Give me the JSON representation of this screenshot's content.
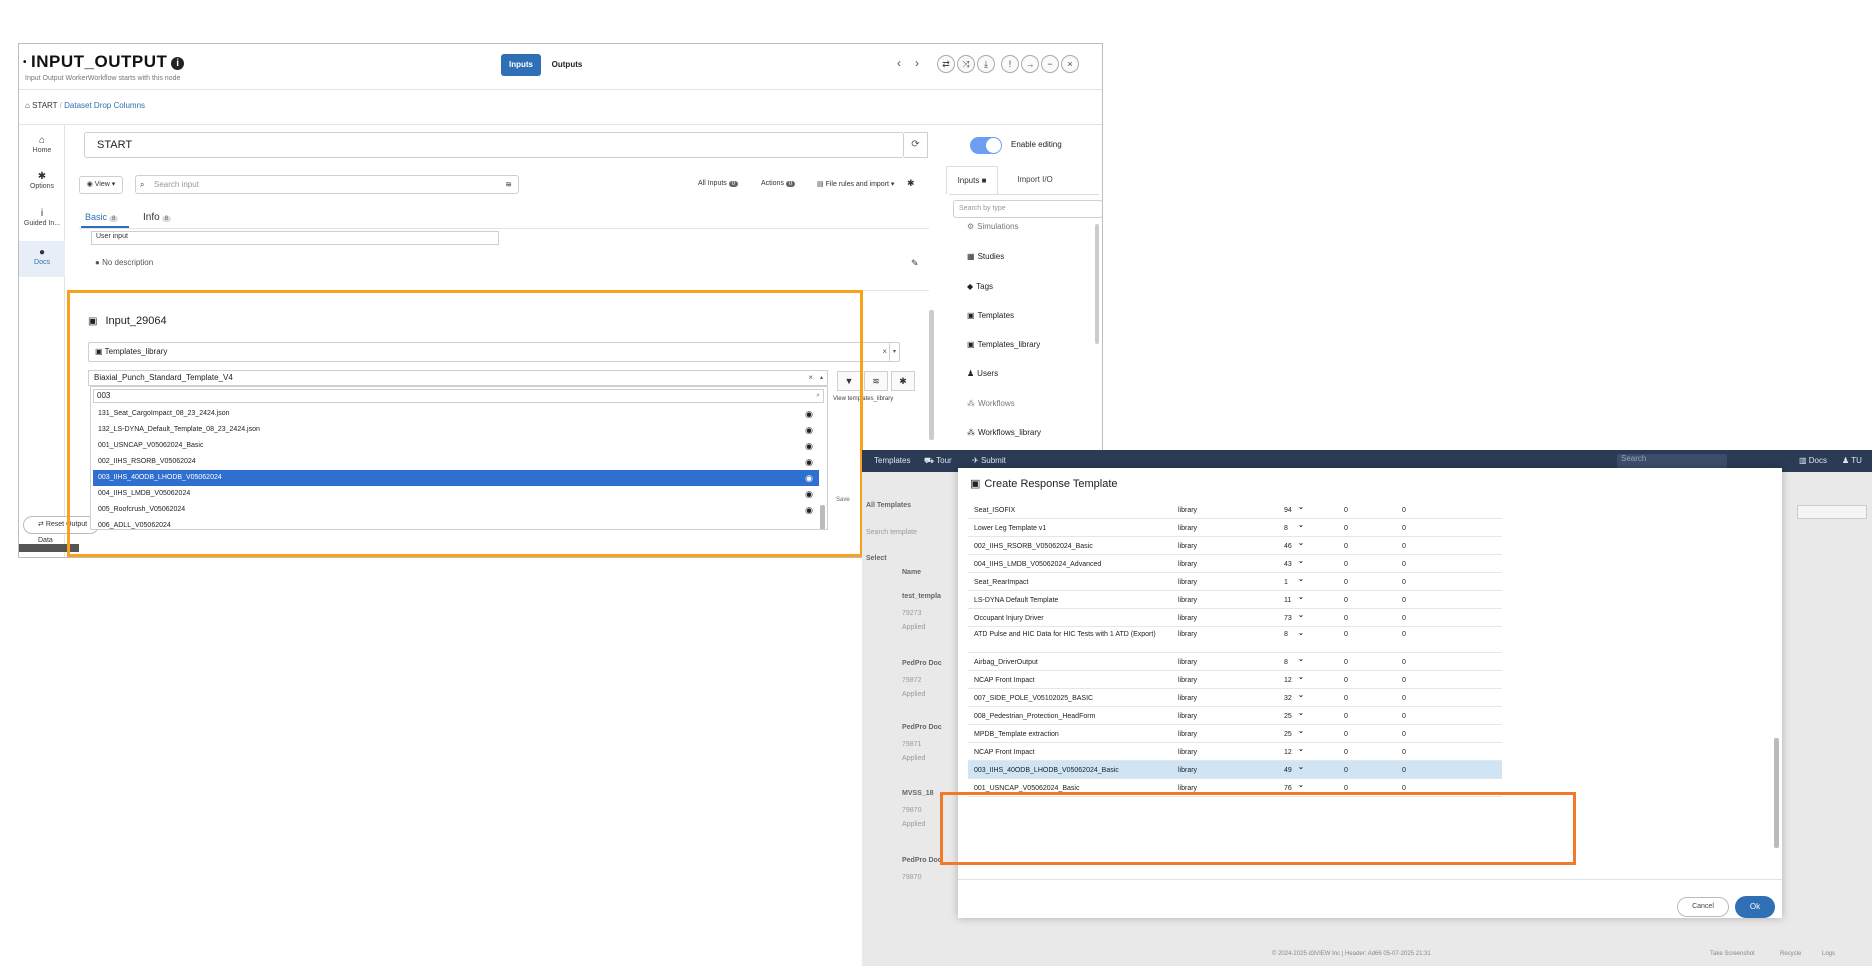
{
  "win1": {
    "title": "INPUT_OUTPUT",
    "subtitle": "Input Output WorkerWorkflow starts with this node",
    "btn_inputs": "Inputs",
    "btn_outputs": "Outputs",
    "nav_prev": "‹",
    "nav_next": "›",
    "breadcrumb_start": "START",
    "breadcrumb_sep": "/",
    "breadcrumb_link": "Dataset Drop Columns",
    "sidebar": {
      "home": "Home",
      "options": "Options",
      "guided": "Guided In...",
      "docs": "Docs"
    },
    "start_value": "START",
    "view_label": "View ▾",
    "search_placeholder": "Search input",
    "all_inputs": "All Inputs",
    "actions": "Actions",
    "file_rules": "File rules and import ▾",
    "tab_basic": "Basic",
    "tab_info": "Info",
    "user_input": "User input",
    "no_description": "No description",
    "enable_editing": "Enable editing",
    "right_tab_inputs": "Inputs",
    "right_tab_import": "Import I/O",
    "right_search_placeholder": "Search by type",
    "right_list": [
      "Simulations",
      "Studies",
      "Tags",
      "Templates",
      "Templates_library",
      "Users",
      "Workflows",
      "Workflows_library"
    ],
    "reset_label": "Reset",
    "output_data": "Output Data",
    "input_name": "Input_29064",
    "templates_library": "Templates_library",
    "selected_value": "Biaxial_Punch_Standard_Template_V4",
    "view_templates": "View templates_library",
    "dropdown_query": "003",
    "dropdown_items": [
      "131_Seat_CargoImpact_08_23_2424.json",
      "132_LS-DYNA_Default_Template_08_23_2424.json",
      "001_USNCAP_V05062024_Basic",
      "002_IIHS_RSORB_V05062024",
      "003_IIHS_40ODB_LHODB_V05062024",
      "004_IIHS_LMDB_V05062024",
      "005_Roofcrush_V05062024",
      "006_ADLL_V05062024"
    ],
    "dropdown_selected_index": 4,
    "save_label": "Save"
  },
  "win2": {
    "nav": [
      "Templates",
      "Tour",
      "Submit"
    ],
    "nav_search": "Search",
    "nav_docs": "Docs",
    "nav_user": "TU",
    "bg_all_templates": "All Templates",
    "bg_search": "Search template",
    "bg_select": "Select",
    "bg_name": "Name",
    "bg_rows": [
      "test_templa",
      "PedPro Doc",
      "PedPro Doc",
      "MVSS_18",
      "PedPro Doc"
    ],
    "bg_ids": [
      "79273",
      "79872",
      "79871",
      "79870",
      "79870"
    ],
    "bg_applied": "Applied",
    "footer": "© 2024-2025 d3VIEW Inc | Header: Ad66 05-07-2025 21:31",
    "footer_right": [
      "Take Screenshot",
      "Recycle",
      "Logs"
    ],
    "modal_title": "Create Response Template",
    "modal_rows": [
      {
        "name": "Seat_ISOFIX",
        "type": "library",
        "n": "94",
        "a": "0",
        "b": "0"
      },
      {
        "name": "Lower Leg Template v1",
        "type": "library",
        "n": "8",
        "a": "0",
        "b": "0"
      },
      {
        "name": "002_IIHS_RSORB_V05062024_Basic",
        "type": "library",
        "n": "46",
        "a": "0",
        "b": "0"
      },
      {
        "name": "004_IIHS_LMDB_V05062024_Advanced",
        "type": "library",
        "n": "43",
        "a": "0",
        "b": "0"
      },
      {
        "name": "Seat_RearImpact",
        "type": "library",
        "n": "1",
        "a": "0",
        "b": "0"
      },
      {
        "name": "LS-DYNA Default Template",
        "type": "library",
        "n": "11",
        "a": "0",
        "b": "0"
      },
      {
        "name": "Occupant Injury Driver",
        "type": "library",
        "n": "73",
        "a": "0",
        "b": "0"
      },
      {
        "name": "ATD Pulse and HIC Data for HIC Tests with 1 ATD (Export)",
        "type": "library",
        "n": "8",
        "a": "0",
        "b": "0"
      },
      {
        "name": "Airbag_DriverOutput",
        "type": "library",
        "n": "8",
        "a": "0",
        "b": "0"
      },
      {
        "name": "NCAP Front Impact",
        "type": "library",
        "n": "12",
        "a": "0",
        "b": "0"
      },
      {
        "name": "007_SIDE_POLE_V05102025_BASIC",
        "type": "library",
        "n": "32",
        "a": "0",
        "b": "0"
      },
      {
        "name": "008_Pedestrian_Protection_HeadForm",
        "type": "library",
        "n": "25",
        "a": "0",
        "b": "0"
      },
      {
        "name": "MPDB_Template extraction",
        "type": "library",
        "n": "25",
        "a": "0",
        "b": "0"
      },
      {
        "name": "NCAP Front Impact",
        "type": "library",
        "n": "12",
        "a": "0",
        "b": "0"
      },
      {
        "name": "003_IIHS_40ODB_LHODB_V05062024_Basic",
        "type": "library",
        "n": "49",
        "a": "0",
        "b": "0"
      },
      {
        "name": "001_USNCAP_V05062024_Basic",
        "type": "library",
        "n": "76",
        "a": "0",
        "b": "0"
      }
    ],
    "modal_highlight_index": 14,
    "cancel_label": "Cancel",
    "ok_label": "Ok"
  },
  "colors": {
    "accent": "#2f6fb5",
    "highlight_orange_left": "#f7a21b",
    "highlight_orange_right": "#f07a2a",
    "selected_row": "#2f6fd0",
    "modal_highlight_row": "#cfe5f6"
  }
}
